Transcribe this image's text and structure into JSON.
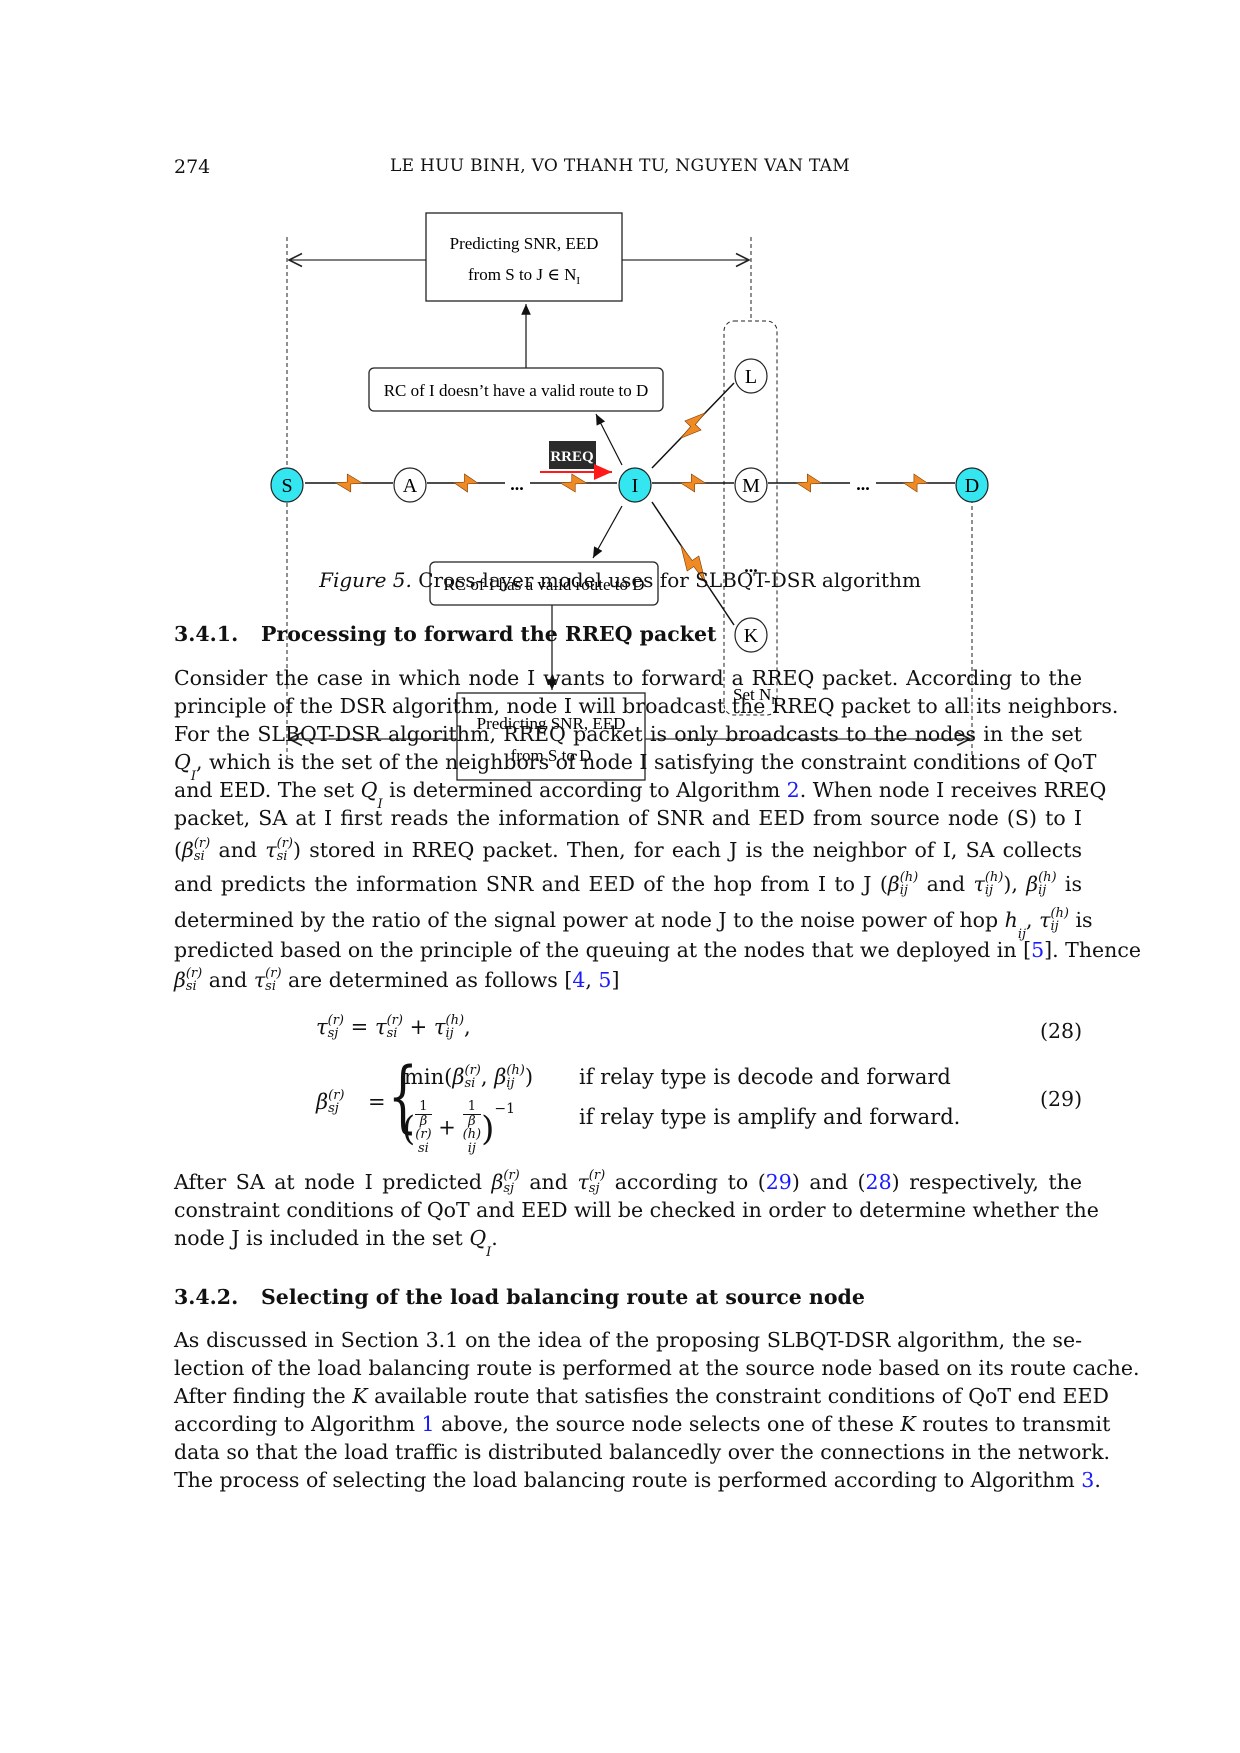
{
  "header": {
    "page_number": "274",
    "authors": "LE HUU BINH, VO THANH TU, NGUYEN VAN TAM"
  },
  "figure": {
    "nodes": {
      "S": "S",
      "A": "A",
      "I": "I",
      "L": "L",
      "M": "M",
      "K": "K",
      "D": "D"
    },
    "ellipsis": "...",
    "box_top": [
      "Predicting SNR, EED",
      "from S to J ∈ N",
      "I"
    ],
    "box_no_route": "RC of I doesn’t have a valid route to D",
    "box_has_route": "RC of I has a valid route to D",
    "box_bottom": [
      "Predicting SNR, EED",
      "from S to D"
    ],
    "rreq_label": "RREQ",
    "set_label": [
      "Set N",
      "I"
    ],
    "colors": {
      "highlight_node": "#33e6f0",
      "link_bolt": "#f08a24",
      "rreq_arrow": "#ff1a1a",
      "rreq_label_bg": "#2b2b2b"
    },
    "caption_label": "Figure 5.",
    "caption_text": " Cross-layer model uses for SLBQT-DSR algorithm"
  },
  "section_341": {
    "number": "3.4.1.",
    "title": "Processing to forward the RREQ packet"
  },
  "section_342": {
    "number": "3.4.2.",
    "title": "Selecting of the load balancing route at source node"
  },
  "para1": [
    [
      {
        "t": "Consider the case in which node I wants to forward a RREQ packet.  According to the"
      }
    ],
    [
      {
        "t": "principle of the DSR algorithm, node I will broadcast the RREQ packet to all its neighbors."
      }
    ],
    [
      {
        "t": "For the SLBQT-DSR algorithm, RREQ packet is only broadcasts to the nodes in the set"
      }
    ],
    [
      {
        "m": "Q",
        "sub": "I"
      },
      {
        "t": ", which is the set of the neighbors of node I satisfying the constraint conditions of QoT"
      }
    ],
    [
      {
        "t": "and EED. The set "
      },
      {
        "m": "Q",
        "sub": "I"
      },
      {
        "t": " is determined according to Algorithm "
      },
      {
        "link": "2"
      },
      {
        "t": ". When node I receives RREQ"
      }
    ],
    [
      {
        "t": "packet, SA at I first reads the information of SNR and EED from source node (S) to I"
      }
    ],
    [
      {
        "t": "("
      },
      {
        "m": "β",
        "sup": "(r)",
        "sub": "si"
      },
      {
        "t": " and "
      },
      {
        "m": "τ",
        "sup": "(r)",
        "sub": "si"
      },
      {
        "t": ") stored in RREQ packet.  Then, for each J is the neighbor of I, SA collects"
      }
    ],
    [
      {
        "t": "and predicts the information SNR and EED of the hop from I to J ("
      },
      {
        "m": "β",
        "sup": "(h)",
        "sub": "ij"
      },
      {
        "t": " and "
      },
      {
        "m": "τ",
        "sup": "(h)",
        "sub": "ij"
      },
      {
        "t": "), "
      },
      {
        "m": "β",
        "sup": "(h)",
        "sub": "ij"
      },
      {
        "t": " is"
      }
    ],
    [
      {
        "t": "determined by the ratio of the signal power at node J to the noise power of hop "
      },
      {
        "m": "h",
        "sub": "ij"
      },
      {
        "t": ", "
      },
      {
        "m": "τ",
        "sup": "(h)",
        "sub": "ij"
      },
      {
        "t": " is"
      }
    ],
    [
      {
        "t": "predicted based on the principle of the queuing at the nodes that we deployed in ["
      },
      {
        "link": "5"
      },
      {
        "t": "]. Thence"
      }
    ],
    [
      {
        "m": "β",
        "sup": "(r)",
        "sub": "si"
      },
      {
        "t": " and "
      },
      {
        "m": "τ",
        "sup": "(r)",
        "sub": "si"
      },
      {
        "t": " are determined as follows ["
      },
      {
        "link": "4"
      },
      {
        "t": ", "
      },
      {
        "link": "5"
      },
      {
        "t": "]"
      }
    ]
  ],
  "equations": {
    "eq28": {
      "lhs": "τ",
      "lhs_sup": "(r)",
      "lhs_sub": "sj",
      "rhs": [
        {
          "m": "τ",
          "sup": "(r)",
          "sub": "si"
        },
        {
          "t": " + "
        },
        {
          "m": "τ",
          "sup": "(h)",
          "sub": "ij"
        },
        {
          "t": ","
        }
      ],
      "number": "(28)"
    },
    "eq29": {
      "lhs": "β",
      "lhs_sup": "(r)",
      "lhs_sub": "sj",
      "case1_expr": [
        {
          "t": "min("
        },
        {
          "m": "β",
          "sup": "(r)",
          "sub": "si"
        },
        {
          "t": ", "
        },
        {
          "m": "β",
          "sup": "(h)",
          "sub": "ij"
        },
        {
          "t": ")"
        }
      ],
      "case1_cond": "if relay type is decode and forward",
      "case2_cond": "if relay type is amplify and forward.",
      "case2_one": "1",
      "case2_exp": "−1",
      "number": "(29)"
    }
  },
  "para2": [
    [
      {
        "t": "After SA at node I predicted "
      },
      {
        "m": "β",
        "sup": "(r)",
        "sub": "sj"
      },
      {
        "t": " and "
      },
      {
        "m": "τ",
        "sup": "(r)",
        "sub": "sj"
      },
      {
        "t": " according to ("
      },
      {
        "link": "29"
      },
      {
        "t": ") and ("
      },
      {
        "link": "28"
      },
      {
        "t": ") respectively, the"
      }
    ],
    [
      {
        "t": "constraint conditions of QoT and EED will be checked in order to determine whether the"
      }
    ],
    [
      {
        "t": "node J is included in the set "
      },
      {
        "m": "Q",
        "sub": "I"
      },
      {
        "t": "."
      }
    ]
  ],
  "para3": [
    [
      {
        "t": "As discussed in Section 3.1 on the idea of the proposing SLBQT-DSR algorithm, the se-"
      }
    ],
    [
      {
        "t": "lection of the load balancing route is performed at the source node based on its route cache."
      }
    ],
    [
      {
        "t": "After finding the "
      },
      {
        "m": "K"
      },
      {
        "t": " available route that satisfies the constraint conditions of QoT end EED"
      }
    ],
    [
      {
        "t": "according to Algorithm "
      },
      {
        "link": "1"
      },
      {
        "t": " above, the source node selects one of these "
      },
      {
        "m": "K"
      },
      {
        "t": " routes to transmit"
      }
    ],
    [
      {
        "t": "data so that the load traffic is distributed balancedly over the connections in the network."
      }
    ],
    [
      {
        "t": "The process of selecting the load balancing route is performed according to Algorithm "
      },
      {
        "link": "3"
      },
      {
        "t": "."
      }
    ]
  ]
}
